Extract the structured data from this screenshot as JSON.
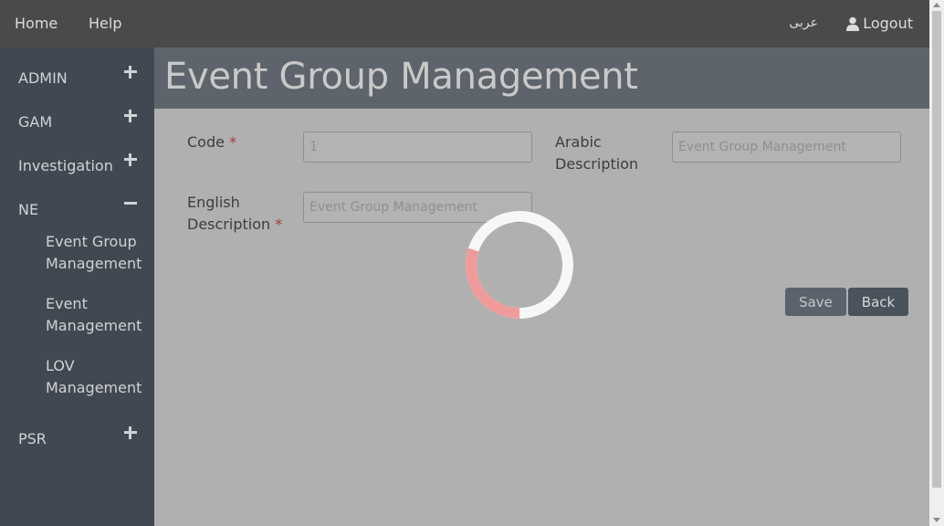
{
  "topbar": {
    "home": "Home",
    "help": "Help",
    "language": "عربى",
    "logout": "Logout"
  },
  "sidebar": {
    "items": [
      {
        "label": "ADMIN",
        "toggle": "plus"
      },
      {
        "label": "GAM",
        "toggle": "plus"
      },
      {
        "label": "Investigation",
        "toggle": "plus"
      },
      {
        "label": "NE",
        "toggle": "minus"
      },
      {
        "label": "PSR",
        "toggle": "plus"
      }
    ],
    "subitems": [
      {
        "line1": "Event Group",
        "line2": "Management"
      },
      {
        "line1": "Event",
        "line2": "Management"
      },
      {
        "line1": "LOV",
        "line2": "Management"
      }
    ]
  },
  "page": {
    "title": "Event Group Management"
  },
  "form": {
    "code_label": "Code",
    "code_value": "1",
    "arabic_label_1": "Arabic",
    "arabic_label_2": "Description",
    "arabic_placeholder": "Event Group Management",
    "english_label_1": "English",
    "english_label_2": "Description",
    "english_placeholder": "Event Group Management",
    "required_mark": "*"
  },
  "buttons": {
    "save": "Save",
    "back": "Back"
  },
  "loading": {
    "progress": 0.3,
    "track_color": "#f7f7f7",
    "arc_color": "#f09b9b"
  },
  "colors": {
    "topbar": "#4a4a4a",
    "sidebar": "#414851",
    "header": "#5e646c",
    "content": "#b0b0b0",
    "required": "#a33a3a"
  }
}
